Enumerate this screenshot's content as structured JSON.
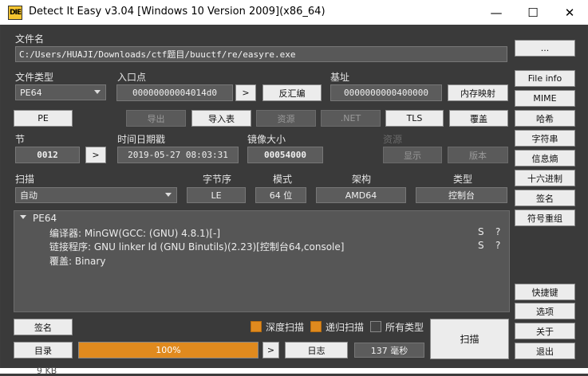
{
  "window": {
    "title": "Detect It Easy v3.04 [Windows 10 Version 2009](x86_64)",
    "icon_text": "DIE",
    "minimize": "—",
    "maximize": "☐",
    "close": "✕"
  },
  "file": {
    "label": "文件名",
    "path": "C:/Users/HUAJI/Downloads/ctf题目/buuctf/re/easyre.exe",
    "browse": "..."
  },
  "filetype": {
    "label": "文件类型",
    "value": "PE64"
  },
  "entry": {
    "label": "入口点",
    "value": "00000000004014d0",
    "go": ">",
    "disasm": "反汇编"
  },
  "base": {
    "label": "基址",
    "value": "0000000000400000",
    "memmap": "内存映射"
  },
  "row_buttons": {
    "pe": "PE",
    "export": "导出",
    "import": "导入表",
    "resources": "资源",
    "net": ".NET",
    "tls": "TLS",
    "overlay": "覆盖"
  },
  "section": {
    "label": "节",
    "value": "0012",
    "go": ">"
  },
  "timestamp": {
    "label": "时间日期戳",
    "value": "2019-05-27 08:03:31"
  },
  "imagesize": {
    "label": "镜像大小",
    "value": "00054000"
  },
  "res2": {
    "label": "资源",
    "show": "显示",
    "version": "版本"
  },
  "scan": {
    "label": "扫描",
    "value": "自动"
  },
  "endian": {
    "label": "字节序",
    "value": "LE"
  },
  "mode": {
    "label": "模式",
    "value": "64 位"
  },
  "arch": {
    "label": "架构",
    "value": "AMD64"
  },
  "type": {
    "label": "类型",
    "value": "控制台"
  },
  "results": {
    "root": "PE64",
    "lines": [
      {
        "text": "编译器: MinGW(GCC: (GNU) 4.8.1)[-]",
        "s": "S",
        "q": "?"
      },
      {
        "text": "链接程序: GNU linker ld (GNU Binutils)(2.23)[控制台64,console]",
        "s": "S",
        "q": "?"
      },
      {
        "text": "覆盖: Binary",
        "s": "",
        "q": ""
      }
    ]
  },
  "right_panel": {
    "file_info": "File info",
    "mime": "MIME",
    "hash": "哈希",
    "strings": "字符串",
    "entropy": "信息熵",
    "hex": "十六进制",
    "signature": "签名",
    "symbols": "符号重组",
    "shortcuts": "快捷键",
    "options": "选项",
    "about": "关于",
    "exit": "退出"
  },
  "bottom": {
    "signature": "签名",
    "directory": "目录",
    "deep_scan": "深度扫描",
    "recursive_scan": "递归扫描",
    "all_types": "所有类型",
    "progress_text": "100%",
    "progress_value": 100,
    "more": ">",
    "log": "日志",
    "time": "137 毫秒",
    "scan_button": "扫描"
  },
  "behind_text": "9 KB",
  "colors": {
    "accent": "#e08a1e",
    "panel": "#3a3a3a"
  }
}
